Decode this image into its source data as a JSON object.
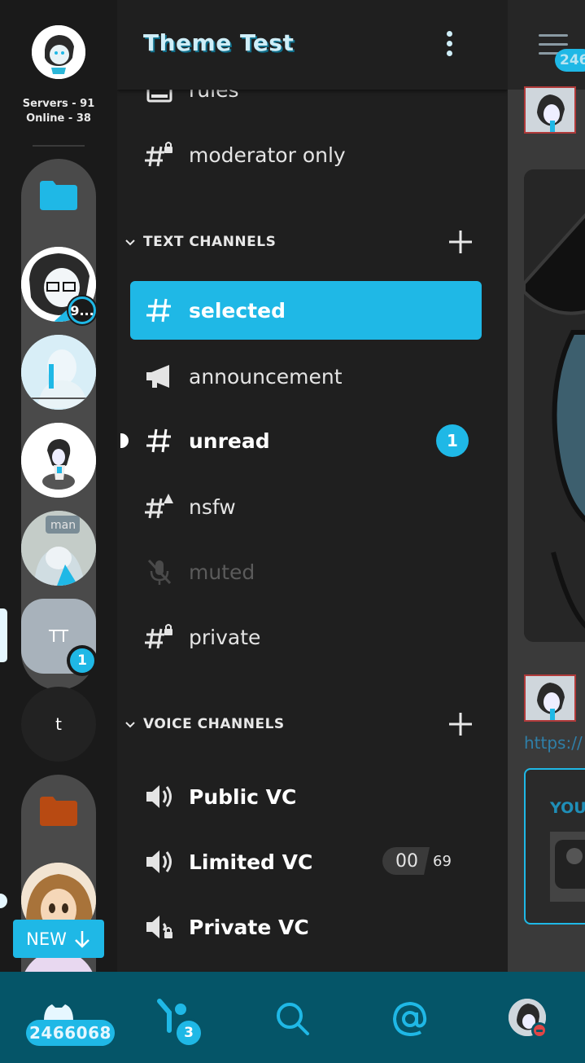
{
  "rail": {
    "stats_line1": "Servers - 91",
    "stats_line2": "Online - 38",
    "server_badge_1": "9...",
    "server_tt_label": "TT",
    "server_tt_badge": "1",
    "server_t_label": "t",
    "man_label": "man",
    "new_pill": "NEW"
  },
  "header": {
    "title": "Theme Test"
  },
  "channels": {
    "top": [
      {
        "name": "rules"
      },
      {
        "name": "moderator only"
      }
    ],
    "text_section": "TEXT CHANNELS",
    "text": [
      {
        "name": "selected",
        "state": "selected"
      },
      {
        "name": "announcement",
        "state": "normal"
      },
      {
        "name": "unread",
        "state": "unread",
        "mentions": "1"
      },
      {
        "name": "nsfw",
        "state": "normal"
      },
      {
        "name": "muted",
        "state": "muted"
      },
      {
        "name": "private",
        "state": "normal"
      }
    ],
    "voice_section": "VOICE CHANNELS",
    "voice": [
      {
        "name": "Public VC"
      },
      {
        "name": "Limited VC",
        "count": "00",
        "limit": "69"
      },
      {
        "name": "Private VC"
      }
    ]
  },
  "chat": {
    "header_badge": "246",
    "link_fragment": "https://",
    "embed_title_fragment": "YOU"
  },
  "bottom_nav": {
    "home_badge": "2466068",
    "friends_badge": "3"
  },
  "colors": {
    "accent": "#1fb8e6",
    "bottom_bar": "#055568",
    "background": "#1f1f1f",
    "folder_blue": "#1fb8e6",
    "folder_orange": "#b84a12"
  }
}
